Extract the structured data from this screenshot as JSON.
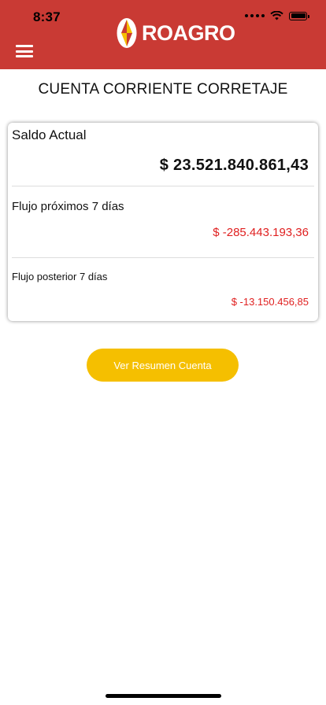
{
  "status_bar": {
    "time": "8:37"
  },
  "header": {
    "brand": "ROAGRO"
  },
  "page": {
    "title": "CUENTA CORRIENTE CORRETAJE"
  },
  "balance_card": {
    "current": {
      "label": "Saldo Actual",
      "amount": "$ 23.521.840.861,43"
    },
    "next_7_days": {
      "label": "Flujo próximos 7 días",
      "amount": "$ -285.443.193,36"
    },
    "after_7_days": {
      "label": "Flujo posterior 7 días",
      "amount": "$ -13.150.456,85"
    }
  },
  "actions": {
    "summary_button": "Ver Resumen Cuenta"
  },
  "colors": {
    "header": "#c93a34",
    "accent": "#f5bf00",
    "negative": "#e02020"
  },
  "icons": [
    "hamburger-menu-icon",
    "roagro-logo-icon",
    "wifi-icon",
    "battery-icon",
    "cellular-signal-icon"
  ]
}
